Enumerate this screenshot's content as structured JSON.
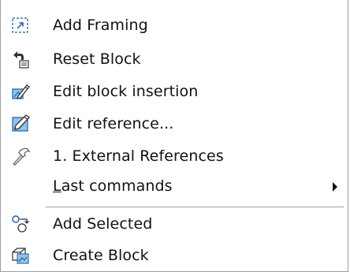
{
  "menu": {
    "items": [
      {
        "label": "Add Framing",
        "icon": "add-framing-icon"
      },
      {
        "label": "Reset Block",
        "icon": "reset-block-icon"
      },
      {
        "label": "Edit block insertion",
        "icon": "edit-block-insertion-icon"
      },
      {
        "label": "Edit reference...",
        "icon": "edit-reference-icon"
      },
      {
        "label": "1. External References",
        "icon": "hammer-icon"
      },
      {
        "label": "Last commands",
        "icon": "",
        "has_submenu": true,
        "accelerator": "L"
      },
      {
        "label": "Add Selected",
        "icon": "add-selected-icon"
      },
      {
        "label": "Create Block",
        "icon": "create-block-icon"
      }
    ]
  },
  "colors": {
    "text": "#111111",
    "border": "#a0a0a0",
    "icon_blue": "#1f5fa8",
    "icon_dark": "#333333",
    "icon_light_blue": "#8fc3ea"
  }
}
